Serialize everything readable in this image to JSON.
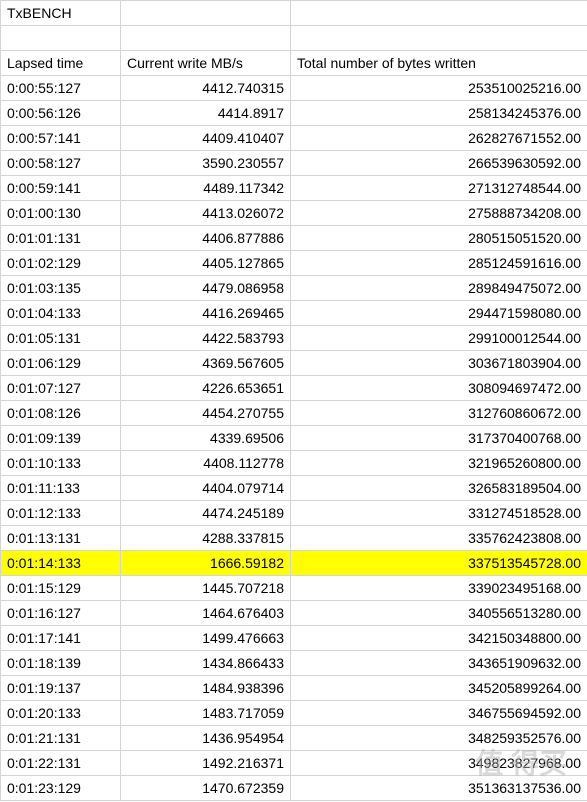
{
  "title": "TxBENCH",
  "headers": {
    "col1": "Lapsed time",
    "col2": "Current write MB/s",
    "col3": "Total number of bytes written"
  },
  "rows": [
    {
      "time": "0:00:55:127",
      "write": "4412.740315",
      "bytes": "253510025216.00",
      "hl": false
    },
    {
      "time": "0:00:56:126",
      "write": "4414.8917",
      "bytes": "258134245376.00",
      "hl": false
    },
    {
      "time": "0:00:57:141",
      "write": "4409.410407",
      "bytes": "262827671552.00",
      "hl": false
    },
    {
      "time": "0:00:58:127",
      "write": "3590.230557",
      "bytes": "266539630592.00",
      "hl": false
    },
    {
      "time": "0:00:59:141",
      "write": "4489.117342",
      "bytes": "271312748544.00",
      "hl": false
    },
    {
      "time": "0:01:00:130",
      "write": "4413.026072",
      "bytes": "275888734208.00",
      "hl": false
    },
    {
      "time": "0:01:01:131",
      "write": "4406.877886",
      "bytes": "280515051520.00",
      "hl": false
    },
    {
      "time": "0:01:02:129",
      "write": "4405.127865",
      "bytes": "285124591616.00",
      "hl": false
    },
    {
      "time": "0:01:03:135",
      "write": "4479.086958",
      "bytes": "289849475072.00",
      "hl": false
    },
    {
      "time": "0:01:04:133",
      "write": "4416.269465",
      "bytes": "294471598080.00",
      "hl": false
    },
    {
      "time": "0:01:05:131",
      "write": "4422.583793",
      "bytes": "299100012544.00",
      "hl": false
    },
    {
      "time": "0:01:06:129",
      "write": "4369.567605",
      "bytes": "303671803904.00",
      "hl": false
    },
    {
      "time": "0:01:07:127",
      "write": "4226.653651",
      "bytes": "308094697472.00",
      "hl": false
    },
    {
      "time": "0:01:08:126",
      "write": "4454.270755",
      "bytes": "312760860672.00",
      "hl": false
    },
    {
      "time": "0:01:09:139",
      "write": "4339.69506",
      "bytes": "317370400768.00",
      "hl": false
    },
    {
      "time": "0:01:10:133",
      "write": "4408.112778",
      "bytes": "321965260800.00",
      "hl": false
    },
    {
      "time": "0:01:11:133",
      "write": "4404.079714",
      "bytes": "326583189504.00",
      "hl": false
    },
    {
      "time": "0:01:12:133",
      "write": "4474.245189",
      "bytes": "331274518528.00",
      "hl": false
    },
    {
      "time": "0:01:13:131",
      "write": "4288.337815",
      "bytes": "335762423808.00",
      "hl": false
    },
    {
      "time": "0:01:14:133",
      "write": "1666.59182",
      "bytes": "337513545728.00",
      "hl": true
    },
    {
      "time": "0:01:15:129",
      "write": "1445.707218",
      "bytes": "339023495168.00",
      "hl": false
    },
    {
      "time": "0:01:16:127",
      "write": "1464.676403",
      "bytes": "340556513280.00",
      "hl": false
    },
    {
      "time": "0:01:17:141",
      "write": "1499.476663",
      "bytes": "342150348800.00",
      "hl": false
    },
    {
      "time": "0:01:18:139",
      "write": "1434.866433",
      "bytes": "343651909632.00",
      "hl": false
    },
    {
      "time": "0:01:19:137",
      "write": "1484.938396",
      "bytes": "345205899264.00",
      "hl": false
    },
    {
      "time": "0:01:20:133",
      "write": "1483.717059",
      "bytes": "346755694592.00",
      "hl": false
    },
    {
      "time": "0:01:21:131",
      "write": "1436.954954",
      "bytes": "348259352576.00",
      "hl": false
    },
    {
      "time": "0:01:22:131",
      "write": "1492.216371",
      "bytes": "349823827968.00",
      "hl": false
    },
    {
      "time": "0:01:23:129",
      "write": "1470.672359",
      "bytes": "351363137536.00",
      "hl": false
    }
  ],
  "watermark": "值 得买"
}
